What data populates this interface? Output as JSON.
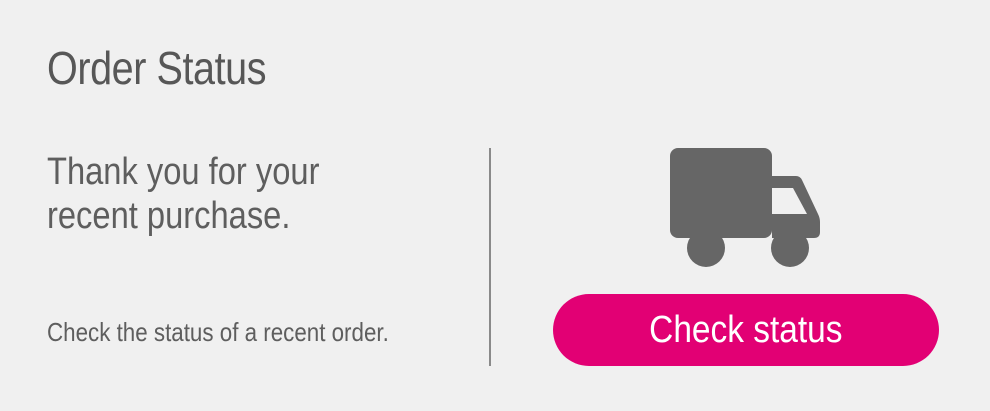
{
  "header": {
    "title": "Order Status"
  },
  "message": {
    "thanks": "Thank you for your recent purchase.",
    "subtext": "Check the status of a recent order."
  },
  "action": {
    "button_label": "Check status",
    "button_color": "#e20074",
    "icon": "truck-icon"
  },
  "colors": {
    "text": "#575757",
    "icon": "#666666",
    "divider": "#8a8a8a",
    "background": "#f0f0f0"
  }
}
